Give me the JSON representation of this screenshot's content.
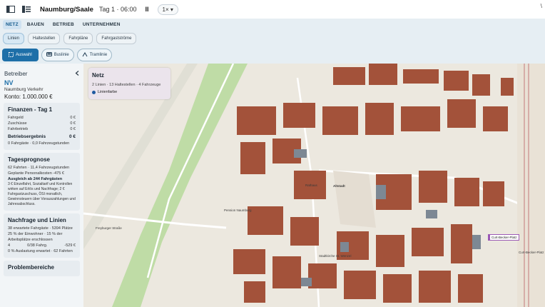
{
  "topbar": {
    "title": "Naumburg/Saale",
    "day_time": "Tag 1 · 06:00",
    "pause": "II",
    "speed": "1× ▾",
    "corner": "\\"
  },
  "nav": {
    "tabs": [
      "NETZ",
      "BAUEN",
      "BETRIEB",
      "UNTERNEHMEN"
    ]
  },
  "subtabs": [
    "Linien",
    "Haltestellen",
    "Fahrpläne",
    "Fahrgastströme"
  ],
  "tools": {
    "select": "Auswahl",
    "bus": "Buslinie",
    "tram": "Tramlinie"
  },
  "sidebar": {
    "title": "Betreiber",
    "operator_code": "NV",
    "operator_name": "Naumburg Verkehr",
    "account": "Konto: 1.000.000 €",
    "finance": {
      "title": "Finanzen - Tag 1",
      "rows": [
        {
          "label": "Fahrgeld",
          "value": "0 €"
        },
        {
          "label": "Zuschüsse",
          "value": "0 €"
        },
        {
          "label": "Fahrbetrieb",
          "value": "0 €"
        }
      ],
      "result_label": "Betriebsergebnis",
      "result_value": "0 €",
      "note": "0 Fahrgäste · 0,0 Fahrzeugstunden"
    },
    "forecast": {
      "title": "Tagesprognose",
      "line1": "62 Fahrten · 11,4 Fahrzeugstunden",
      "line2": "Geplante Personalkosten -475 €",
      "line3": "Ausgleich ab 244 Fahrgästen",
      "line4": "3 € Einzelfahrt, Sozialtarif und Kontrollen wirken auf Erlös und Nachfrage; 2 € Fahrgastzuschuss, ÖSI monatlich, Gewinnsteuern über Vorauszahlungen und Jahresabschluss."
    },
    "demand": {
      "title": "Nachfrage und Linien",
      "line1": "38 erwartete Fahrgäste · 5394 Plätze",
      "line2": "25 % der Einwohner · 15 % der Arbeitsplätze erschlossen",
      "row_left": "4",
      "row_mid": "0/38 Fahrg.",
      "row_right": "-529 €",
      "line3": "0 % Auslastung erwartet · 62 Fahrten"
    },
    "problems": {
      "title": "Problembereiche"
    }
  },
  "map": {
    "panel": {
      "title": "Netz",
      "summary": "2 Linien · 13 Haltestellen · 4 Fahrzeuge",
      "legend": "Linienfarbe"
    },
    "labels": [
      "Altstadt",
      "Freyburger Straße",
      "Pension Naumburg",
      "Rathaus",
      "Stadtkirche St. Wenzel",
      "Curt-Becker-Platz"
    ],
    "station": "Curt-Becker-Platz"
  },
  "colors": {
    "accent": "#1e6fa8",
    "roof": "#a3523a",
    "green": "#b7d9a3",
    "rail": "#c98a8a"
  }
}
